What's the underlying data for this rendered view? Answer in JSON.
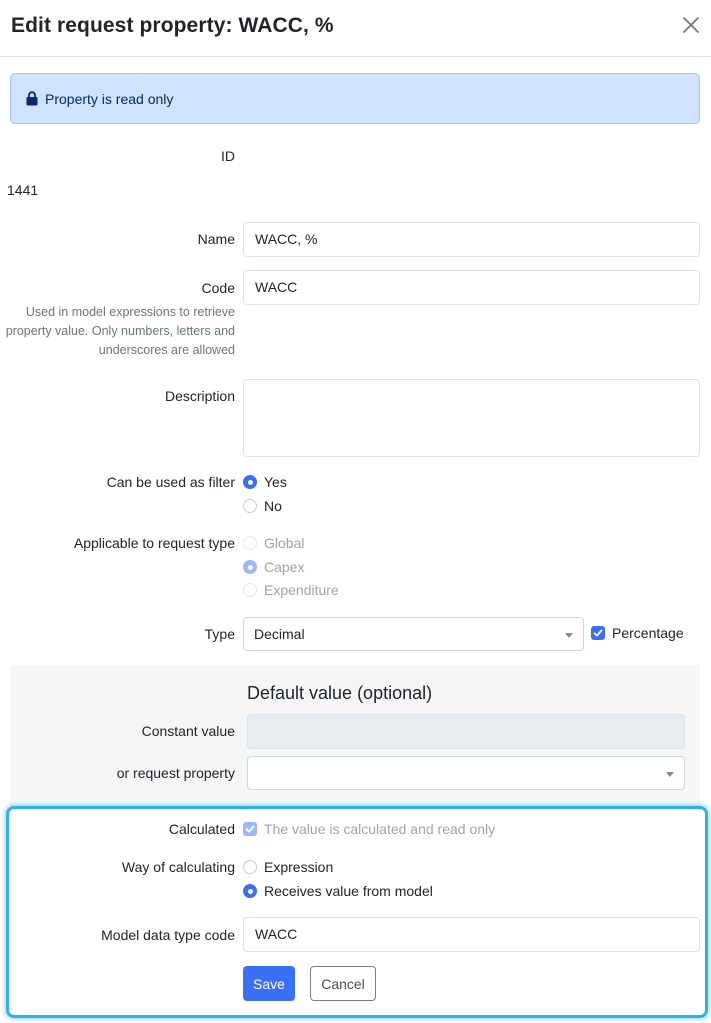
{
  "dialog": {
    "title": "Edit request property: WACC, %",
    "close_icon": "close-icon"
  },
  "alert": {
    "icon": "lock-icon",
    "text": "Property is read only",
    "background": "#cfe2ff"
  },
  "id_field": {
    "label": "ID",
    "value": "1441"
  },
  "name_field": {
    "label": "Name",
    "value": "WACC, %"
  },
  "code_field": {
    "label": "Code",
    "value": "WACC",
    "help_text": "Used in model expressions to retrieve property value. Only numbers, letters and underscores are allowed"
  },
  "description_field": {
    "label": "Description",
    "value": ""
  },
  "filter_field": {
    "label": "Can be used as filter",
    "options": [
      {
        "label": "Yes",
        "selected": true
      },
      {
        "label": "No",
        "selected": false
      }
    ]
  },
  "request_type_field": {
    "label": "Applicable to request type",
    "options": [
      {
        "label": "Global",
        "selected": false
      },
      {
        "label": "Capex",
        "selected": true
      },
      {
        "label": "Expenditure",
        "selected": false
      }
    ]
  },
  "type_field": {
    "label": "Type",
    "selected": "Decimal",
    "percentage_label": "Percentage",
    "percentage_checked": true
  },
  "default_value": {
    "title": "Default value (optional)",
    "constant_label": "Constant value",
    "constant_value": "",
    "request_property_label": "or request property",
    "request_property_value": ""
  },
  "calculated_field": {
    "label": "Calculated",
    "checkbox_label": "The value is calculated and read only",
    "checked": true
  },
  "way_field": {
    "label": "Way of calculating",
    "options": [
      {
        "label": "Expression",
        "selected": false
      },
      {
        "label": "Receives value from model",
        "selected": true
      }
    ]
  },
  "model_code_field": {
    "label": "Model data type code",
    "value": "WACC"
  },
  "actions": {
    "save_label": "Save",
    "cancel_label": "Cancel"
  },
  "colors": {
    "primary": "#3b6ff5",
    "highlight_border": "#2cb2e3"
  }
}
